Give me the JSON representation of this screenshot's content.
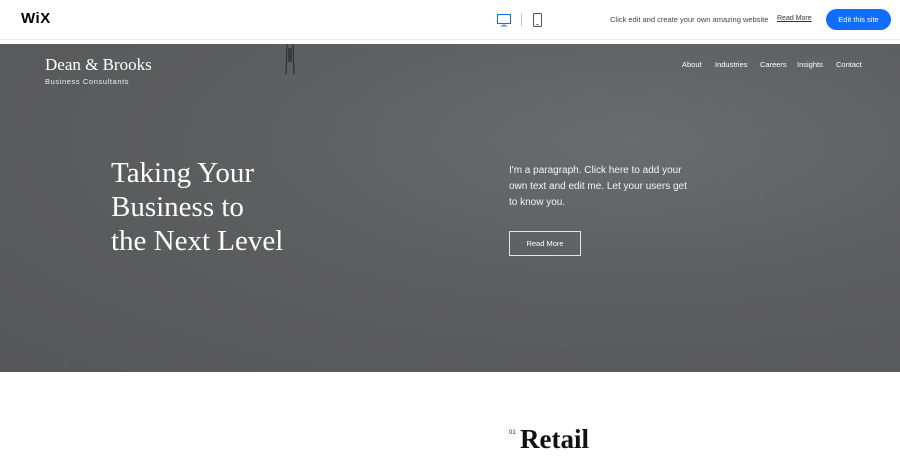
{
  "wix_bar": {
    "logo": "WiX",
    "promo_text": "Click edit and create your own amazing website",
    "promo_link": "Read More",
    "edit_button": "Edit this site",
    "icons": [
      "desktop-icon",
      "mobile-icon"
    ],
    "accent_color": "#116dff"
  },
  "site": {
    "brand_name": "Dean & Brooks",
    "brand_tagline": "Business Consultants",
    "nav": [
      "About",
      "Industries",
      "Careers",
      "Insights",
      "Contact"
    ]
  },
  "hero": {
    "headline": [
      "Taking Your",
      "Business to",
      "the Next Level"
    ],
    "paragraph": "I'm a paragraph. Click here to add your own text and edit me. Let your users get to know you.",
    "button": "Read More",
    "background_color": "#5d5e60"
  },
  "section": {
    "number": "01",
    "title": "Retail"
  }
}
